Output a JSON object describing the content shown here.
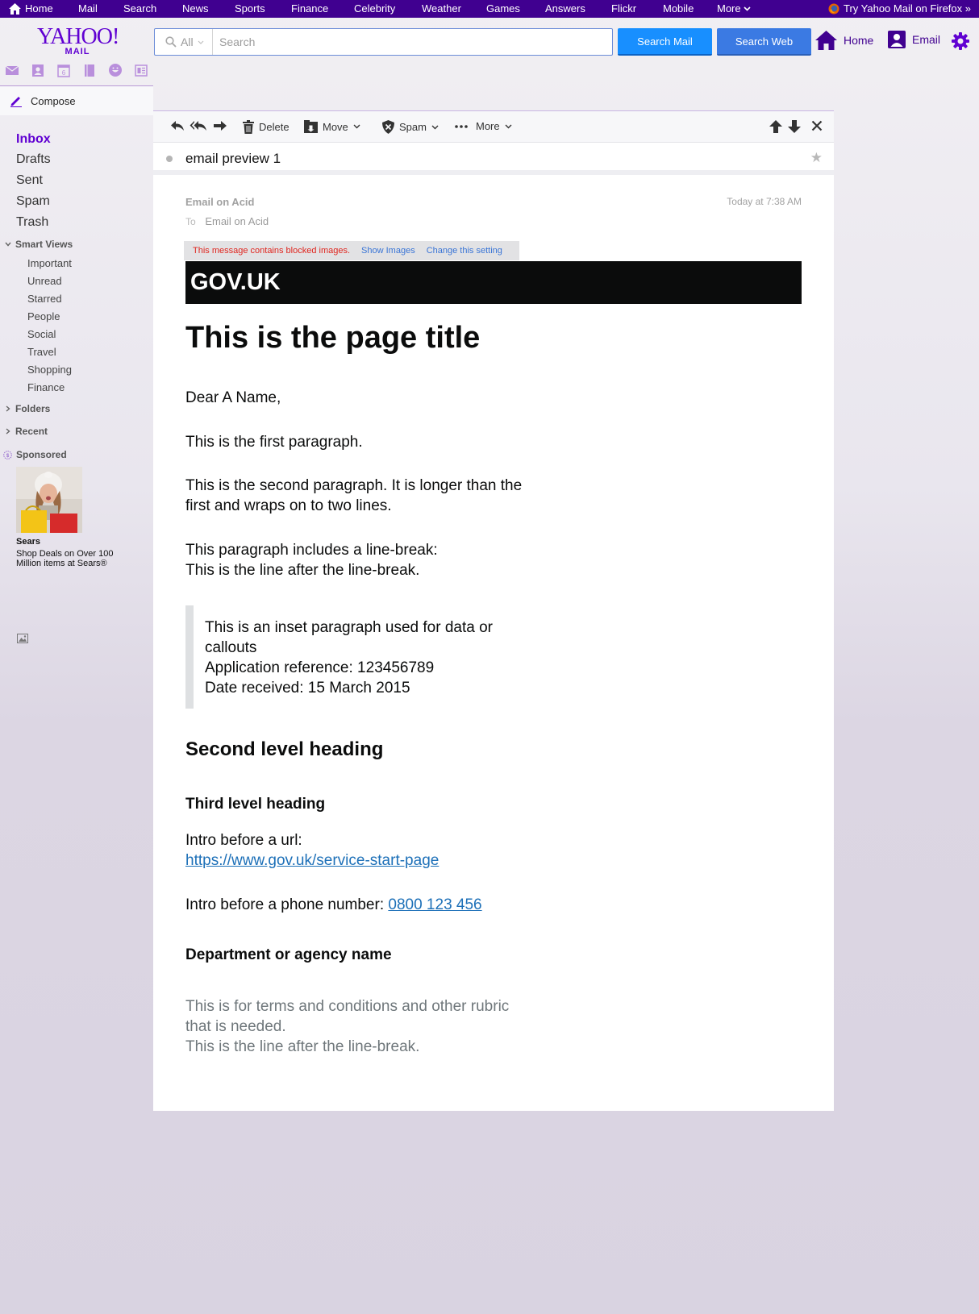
{
  "topnav": {
    "items": [
      "Home",
      "Mail",
      "Search",
      "News",
      "Sports",
      "Finance",
      "Celebrity",
      "Weather",
      "Games",
      "Answers",
      "Flickr",
      "Mobile",
      "More"
    ],
    "firefox_promo": "Try Yahoo Mail on Firefox »"
  },
  "header": {
    "logo_main": "YAHOO!",
    "logo_sub": "MAIL",
    "search_scope": "All",
    "search_placeholder": "Search",
    "search_mail_label": "Search Mail",
    "search_web_label": "Search Web",
    "home_label": "Home",
    "email_label": "Email"
  },
  "sidebar": {
    "compose_label": "Compose",
    "folders": [
      "Inbox",
      "Drafts",
      "Sent",
      "Spam",
      "Trash"
    ],
    "smart_views_label": "Smart Views",
    "smart_views": [
      "Important",
      "Unread",
      "Starred",
      "People",
      "Social",
      "Travel",
      "Shopping",
      "Finance"
    ],
    "folders_label": "Folders",
    "recent_label": "Recent",
    "sponsored_label": "Sponsored",
    "ad_title": "Sears",
    "ad_text": "Shop Deals on Over 100 Million items at Sears®"
  },
  "toolbar": {
    "delete_label": "Delete",
    "move_label": "Move",
    "spam_label": "Spam",
    "more_label": "More"
  },
  "message": {
    "subject": "email preview 1",
    "from": "Email on Acid",
    "date": "Today at 7:38 AM",
    "to_label": "To",
    "to": "Email on Acid",
    "blocked_warning": "This message contains blocked images.",
    "show_images": "Show Images",
    "change_setting": "Change this setting"
  },
  "email_body": {
    "brand": "GOV.UK",
    "title": "This is the page title",
    "greeting": "Dear A Name,",
    "para1": "This is the first paragraph.",
    "para2_line1": "This is the second paragraph. It is longer than the",
    "para2_line2": "first and wraps on to two lines.",
    "para3_line1": "This paragraph includes a line-break:",
    "para3_line2": "This is the line after the line-break.",
    "inset_line1": "This is an inset paragraph used for data or",
    "inset_line2": "callouts",
    "inset_line3": "Application reference: 123456789",
    "inset_line4": "Date received: 15 March 2015",
    "heading2": "Second level heading",
    "heading3": "Third level heading",
    "url_intro": "Intro before a url:",
    "url": "https://www.gov.uk/service-start-page",
    "phone_intro": "Intro before a phone number:",
    "phone": "0800 123 456",
    "department": "Department or agency name",
    "rubric_line1": "This is for terms and conditions and other rubric",
    "rubric_line2": "that is needed.",
    "rubric_line3": "This is the line after the line-break."
  },
  "colors": {
    "nav_bg": "#400090",
    "brand_purple": "#6001d2",
    "search_mail_blue": "#188fff",
    "search_web_blue": "#3b7ae3",
    "govuk_black": "#0b0c0c",
    "link_blue": "#1d70b8",
    "blocked_red": "#e0261f"
  }
}
